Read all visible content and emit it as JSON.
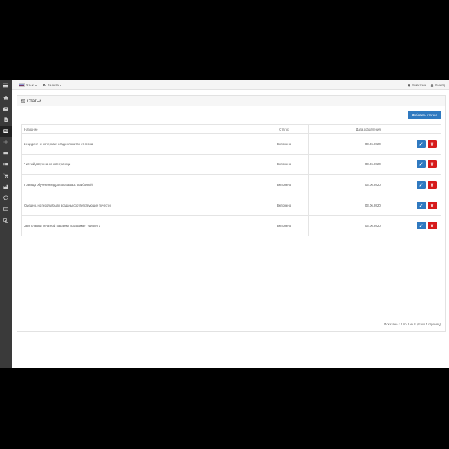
{
  "sidebar": {
    "menu_icon": "menu-icon",
    "items": [
      {
        "icon": "home-icon",
        "active": false
      },
      {
        "icon": "envelope-icon",
        "active": false
      },
      {
        "icon": "document-icon",
        "active": false
      },
      {
        "icon": "newspaper-icon",
        "active": true
      },
      {
        "icon": "plus-icon",
        "active": false
      },
      {
        "icon": "list-icon",
        "active": false
      },
      {
        "icon": "bulleted-list-icon",
        "active": false
      },
      {
        "icon": "cart-icon",
        "active": false
      },
      {
        "icon": "industry-icon",
        "active": false
      },
      {
        "icon": "comments-icon",
        "active": false
      },
      {
        "icon": "money-icon",
        "active": false
      },
      {
        "icon": "copy-icon",
        "active": false
      }
    ]
  },
  "topbar": {
    "language_label": "Язык",
    "currency_symbol": "р.",
    "currency_label": "Валюта",
    "store_link": "В магазин",
    "logout": "Выход"
  },
  "panel": {
    "title": "Статьи",
    "add_button": "Добавить статью"
  },
  "table": {
    "headers": {
      "name": "Название",
      "status": "Статус",
      "date": "Дата добавления"
    },
    "rows": [
      {
        "name": "Инцидент не исчерпан: осадки ложатся от зерна",
        "status": "Включено",
        "date": "03.06.2020"
      },
      {
        "name": "Чистый двоун на основе граници",
        "status": "Включено",
        "date": "03.06.2020"
      },
      {
        "name": "Граница обучения кадров оказалась ошибочной",
        "status": "Включено",
        "date": "03.06.2020"
      },
      {
        "name": "Смешно, но героям были возданы соответствующие почести",
        "status": "Включено",
        "date": "03.06.2020"
      },
      {
        "name": "Звук клавиш печатной машинки продолжает удивлять",
        "status": "Включено",
        "date": "03.06.2020"
      }
    ]
  },
  "pagination": {
    "info": "Показано с 1 по 8 из 8 (всего 1 страниц)"
  },
  "colors": {
    "primary": "#2f79c0",
    "danger": "#d61b1b",
    "sidebar": "#3a3a3a"
  }
}
